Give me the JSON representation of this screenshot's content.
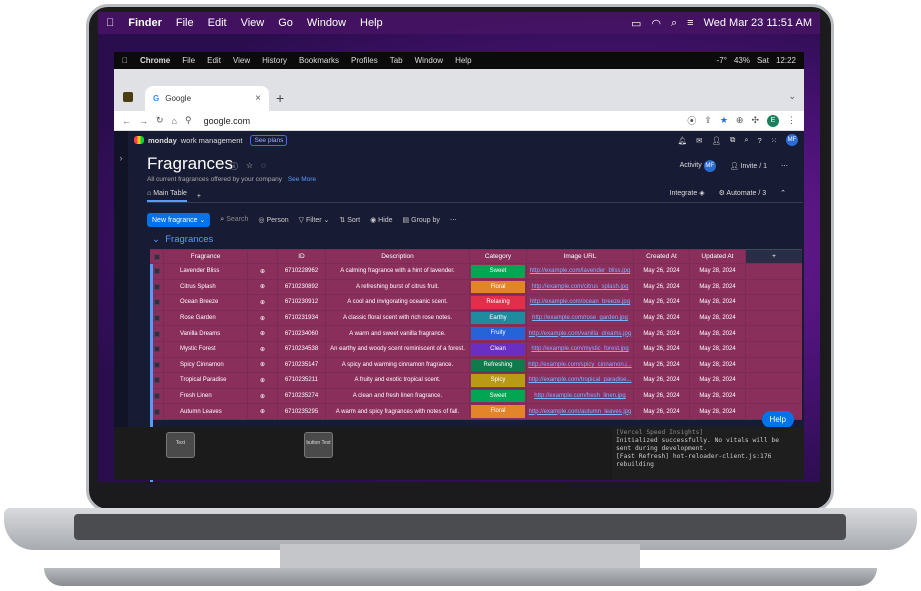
{
  "mac_menubar": {
    "app": "Finder",
    "items": [
      "File",
      "Edit",
      "View",
      "Go",
      "Window",
      "Help"
    ],
    "clock": "Wed Mar 23  11:51 AM"
  },
  "chrome_menubar": {
    "app": "Chrome",
    "items": [
      "File",
      "Edit",
      "View",
      "History",
      "Bookmarks",
      "Profiles",
      "Tab",
      "Window",
      "Help"
    ],
    "weather": "-7°",
    "battery": "43%",
    "day": "Sat",
    "time": "12:22"
  },
  "browser": {
    "tab_title": "Google",
    "new_tab": "+",
    "url": "google.com",
    "profile_initial": "E"
  },
  "app": {
    "brand": "monday",
    "brand_suffix": "work management",
    "see_plans": "See plans",
    "user_initials": "MF",
    "board_title": "Fragrances",
    "board_description": "All current fragrances offered by your company",
    "see_more": "See More",
    "activity": "Activity",
    "invite": "Invite / 1",
    "main_table": "Main Table",
    "add_view": "+",
    "integrate": "Integrate",
    "automate": "Automate / 3",
    "toolbar": {
      "new_item": "New fragrance",
      "search": "Search",
      "person": "Person",
      "filter": "Filter",
      "sort": "Sort",
      "hide": "Hide",
      "group_by": "Group by"
    },
    "group_title": "Fragrances",
    "help": "Help"
  },
  "table": {
    "columns": [
      "Fragrance",
      "ID",
      "Description",
      "Category",
      "Image URL",
      "Created At",
      "Updated At",
      "+"
    ],
    "rows": [
      {
        "name": "Lavender Bliss",
        "id": "6710228962",
        "desc": "A calming fragrance with a hint of lavender.",
        "cat": "Sweet",
        "url": "http://example.com/lavender_bliss.jpg",
        "created": "May 26, 2024",
        "updated": "May 28, 2024"
      },
      {
        "name": "Citrus Splash",
        "id": "6710230892",
        "desc": "A refreshing burst of citrus fruit.",
        "cat": "Floral",
        "url": "http://example.com/citrus_splash.jpg",
        "created": "May 26, 2024",
        "updated": "May 28, 2024"
      },
      {
        "name": "Ocean Breeze",
        "id": "6710230912",
        "desc": "A cool and invigorating oceanic scent.",
        "cat": "Relaxing",
        "url": "http://example.com/ocean_breeze.jpg",
        "created": "May 26, 2024",
        "updated": "May 28, 2024"
      },
      {
        "name": "Rose Garden",
        "id": "6710231934",
        "desc": "A classic floral scent with rich rose notes.",
        "cat": "Earthy",
        "url": "http://example.com/rose_garden.jpg",
        "created": "May 26, 2024",
        "updated": "May 28, 2024"
      },
      {
        "name": "Vanilla Dreams",
        "id": "6710234060",
        "desc": "A warm and sweet vanilla fragrance.",
        "cat": "Fruity",
        "url": "http://example.com/vanilla_dreams.jpg",
        "created": "May 26, 2024",
        "updated": "May 28, 2024"
      },
      {
        "name": "Mystic Forest",
        "id": "6710234538",
        "desc": "An earthy and woody scent reminiscent of a forest.",
        "cat": "Clean",
        "url": "http://example.com/mystic_forest.jpg",
        "created": "May 26, 2024",
        "updated": "May 28, 2024"
      },
      {
        "name": "Spicy Cinnamon",
        "id": "6710235147",
        "desc": "A spicy and warming cinnamon fragrance.",
        "cat": "Refreshing",
        "url": "http://example.com/spicy_cinnamon.j...",
        "created": "May 26, 2024",
        "updated": "May 28, 2024"
      },
      {
        "name": "Tropical Paradise",
        "id": "6710235211",
        "desc": "A fruity and exotic tropical scent.",
        "cat": "Spicy",
        "url": "http://example.com/tropical_paradise...",
        "created": "May 26, 2024",
        "updated": "May 28, 2024"
      },
      {
        "name": "Fresh Linen",
        "id": "6710235274",
        "desc": "A clean and fresh linen fragrance.",
        "cat": "Sweet",
        "url": "http://example.com/fresh_linen.jpg",
        "created": "May 26, 2024",
        "updated": "May 28, 2024"
      },
      {
        "name": "Autumn Leaves",
        "id": "6710235295",
        "desc": "A warm and spicy fragrances with notes of fall.",
        "cat": "Floral",
        "url": "http://example.com/autumn_leaves.jpg",
        "created": "May 26, 2024",
        "updated": "May 28, 2024"
      }
    ]
  },
  "category_colors": {
    "Sweet": "#00a651",
    "Floral": "#e2852a",
    "Relaxing": "#df2f4a",
    "Earthy": "#1e8c9e",
    "Fruity": "#2464d6",
    "Clean": "#6a2ec2",
    "Refreshing": "#0f7a4b",
    "Spicy": "#b89a14"
  },
  "bottom": {
    "chip1": "Text",
    "chip2": "button Text",
    "console_lines": [
      "[Vercel Speed Insights]",
      " Initialized successfully. No vitals will be",
      " sent during development.",
      "[Fast Refresh]    hot-reloader-client.js:176",
      " rebuilding"
    ]
  }
}
